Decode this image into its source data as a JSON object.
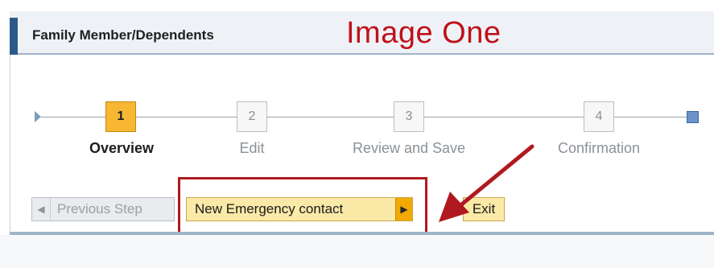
{
  "panel": {
    "title": "Family Member/Dependents",
    "annotation_title": "Image One"
  },
  "roadmap": {
    "steps": [
      {
        "number": "1",
        "label": "Overview",
        "state": "active"
      },
      {
        "number": "2",
        "label": "Edit",
        "state": "inactive"
      },
      {
        "number": "3",
        "label": "Review and Save",
        "state": "inactive"
      },
      {
        "number": "4",
        "label": "Confirmation",
        "state": "inactive"
      }
    ]
  },
  "buttons": {
    "previous": "Previous Step",
    "next": "New Emergency contact",
    "exit": "Exit"
  },
  "icons": {
    "previous_arrow": "triangle-left-icon",
    "next_arrow": "triangle-right-icon",
    "roadmap_start": "roadmap-start-icon",
    "roadmap_end": "roadmap-end-icon",
    "annotation_arrow": "arrow-icon"
  },
  "colors": {
    "active_step": "#f7b733",
    "annotation_red": "#c0111a",
    "button_fill": "#fbe9a8",
    "header_accent": "#2b5a8a"
  }
}
